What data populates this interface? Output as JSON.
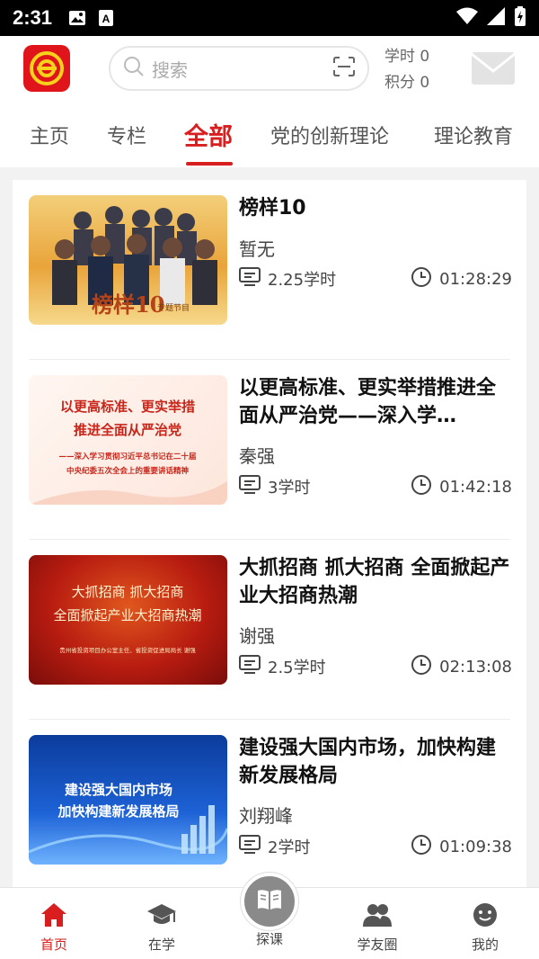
{
  "status_bar": {
    "time": "2:31"
  },
  "header": {
    "search_placeholder": "搜索",
    "study_hours": "学时 0",
    "points": "积分 0"
  },
  "tabs": [
    {
      "label": "主页"
    },
    {
      "label": "专栏"
    },
    {
      "label": "全部",
      "active": true
    },
    {
      "label": "党的创新理论"
    },
    {
      "label": "理论教育"
    }
  ],
  "courses": [
    {
      "title": "榜样10",
      "author": "暂无",
      "hours": "2.25学时",
      "duration": "01:28:29",
      "thumb_text": "榜样10",
      "thumb_sub": "专题节目"
    },
    {
      "title": "以更高标准、更实举措推进全面从严治党——深入学…",
      "author": "秦强",
      "hours": "3学时",
      "duration": "01:42:18",
      "thumb_line1": "以更高标准、更实举措",
      "thumb_line2": "推进全面从严治党",
      "thumb_line3": "——深入学习贯彻习近平总书记在二十届",
      "thumb_line4": "中央纪委五次全会上的重要讲话精神"
    },
    {
      "title": "大抓招商 抓大招商 全面掀起产业大招商热潮",
      "author": "谢强",
      "hours": "2.5学时",
      "duration": "02:13:08",
      "thumb_line1": "大抓招商  抓大招商",
      "thumb_line2": "全面掀起产业大招商热潮",
      "thumb_line3": "贵州省投资项目办公室主任、省投资促进局局长 谢强"
    },
    {
      "title": "建设强大国内市场，加快构建新发展格局",
      "author": "刘翔峰",
      "hours": "2学时",
      "duration": "01:09:38",
      "thumb_line1": "建设强大国内市场",
      "thumb_line2": "加快构建新发展格局"
    }
  ],
  "bottom_nav": [
    {
      "label": "首页",
      "icon": "home-icon",
      "active": true
    },
    {
      "label": "在学",
      "icon": "graduation-cap-icon"
    },
    {
      "label": "探课",
      "icon": "book-icon"
    },
    {
      "label": "学友圈",
      "icon": "people-icon"
    },
    {
      "label": "我的",
      "icon": "smiley-icon"
    }
  ],
  "colors": {
    "accent": "#d81e1e",
    "logo": "#e0141b"
  }
}
